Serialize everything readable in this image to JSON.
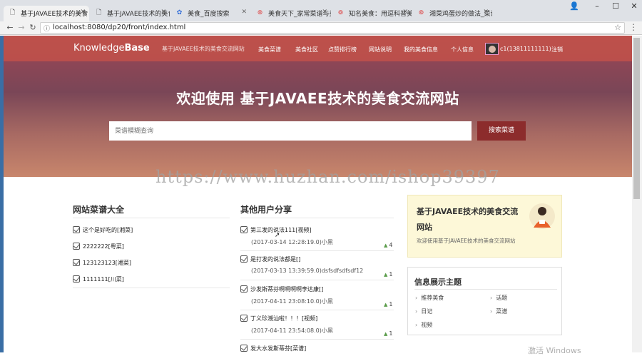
{
  "browser": {
    "tabs": [
      {
        "title": "基于JAVAEE技术的美食",
        "icon": "page-icon",
        "active": true
      },
      {
        "title": "基于JAVAEE技术的美食",
        "icon": "page-icon",
        "active": false
      },
      {
        "title": "美食_百度搜索",
        "icon": "paw-icon",
        "active": false
      },
      {
        "title": "美食天下_家常菜谱与美",
        "icon": "site-icon",
        "active": false
      },
      {
        "title": "知名美食：用逗科普美",
        "icon": "site-icon",
        "active": false
      },
      {
        "title": "湘菜鸡蛋炒的做法_菜谱",
        "icon": "site-icon",
        "active": false
      }
    ],
    "url": "localhost:8080/dp20/front/index.html",
    "window_controls": [
      "–",
      "☐",
      "✕"
    ],
    "user_icon": "👤"
  },
  "site": {
    "brand_plain": "Knowledge",
    "brand_bold": "Base",
    "tagline": "基于JAVAEE技术的美食交流网站",
    "nav": [
      "美食菜谱",
      "美食社区",
      "点赞排行榜",
      "网站说明",
      "我的美食信息",
      "个人信息"
    ],
    "user": "c1(13811111111)",
    "logout": "注销",
    "hero_title": "欢迎使用 基于JAVAEE技术的美食交流网站",
    "search_placeholder": "菜谱模糊查询",
    "search_button": "搜索菜谱",
    "watermark": "https://www.huzhan.com/ishop39397"
  },
  "left_column": {
    "title": "网站菜谱大全",
    "items": [
      "这个是好吃的[湘菜]",
      "2222222[粤菜]",
      "123123123[湘菜]",
      "1111111[川菜]"
    ]
  },
  "middle_column": {
    "title": "其他用户分享",
    "items": [
      {
        "title": "第三发的说法111[视频]",
        "meta": "(2017-03-14 12:28:19.0)小黑",
        "likes": "4"
      },
      {
        "title": "是打发的说法都是[]",
        "meta": "(2017-03-13 13:39:59.0)dsfsdfsdfsdf12",
        "likes": "1"
      },
      {
        "title": "沙发斯蒂芬啊啊啊啊李达康[]",
        "meta": "(2017-04-11 23:08:10.0)小黑",
        "likes": "1"
      },
      {
        "title": "丁义珍潮汕啦！！！[视频]",
        "meta": "(2017-04-11 23:54:08.0)小黑",
        "likes": "1"
      },
      {
        "title": "发大水发斯蒂芬[菜谱]",
        "meta": "",
        "likes": ""
      }
    ]
  },
  "right_column": {
    "promo_title": "基于JAVAEE技术的美食交流网站",
    "promo_sub": "欢迎使用基于JAVAEE技术的美食交流网站",
    "info_title": "信息展示主题",
    "categories": [
      "推荐美食",
      "话题",
      "日记",
      "菜谱",
      "视频"
    ]
  },
  "os": {
    "activation": "激活 Windows"
  }
}
